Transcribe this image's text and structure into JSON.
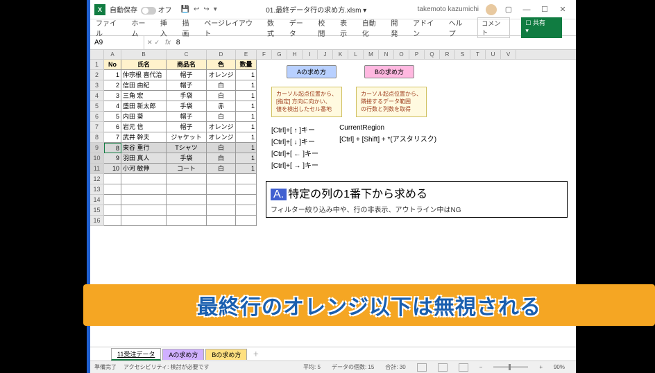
{
  "titlebar": {
    "autosave_label": "自動保存",
    "autosave_state": "オフ",
    "filename": "01.最終データ行の求め方.xlsm ▾",
    "user": "takemoto kazumichi"
  },
  "ribbon": {
    "tabs": [
      "ファイル",
      "ホーム",
      "挿入",
      "描画",
      "ページレイアウト",
      "数式",
      "データ",
      "校閲",
      "表示",
      "自動化",
      "開発",
      "アドイン",
      "ヘルプ"
    ],
    "comment": "コメント",
    "share": "共有"
  },
  "formula": {
    "namebox": "A9",
    "value": "8"
  },
  "columns": [
    "A",
    "B",
    "C",
    "D",
    "E",
    "F",
    "G",
    "H",
    "I",
    "J",
    "K",
    "L",
    "M",
    "N",
    "O",
    "P",
    "Q",
    "R",
    "S",
    "T",
    "U",
    "V"
  ],
  "table": {
    "headers": {
      "no": "No",
      "name": "氏名",
      "product": "商品名",
      "color": "色",
      "qty": "数量"
    },
    "rows": [
      {
        "no": "1",
        "name": "仲宗根 喜代治",
        "product": "帽子",
        "color": "オレンジ",
        "qty": "1"
      },
      {
        "no": "2",
        "name": "信田 由紀",
        "product": "帽子",
        "color": "白",
        "qty": "1"
      },
      {
        "no": "3",
        "name": "三角 宏",
        "product": "手袋",
        "color": "白",
        "qty": "1"
      },
      {
        "no": "4",
        "name": "盛田 新太郎",
        "product": "手袋",
        "color": "赤",
        "qty": "1"
      },
      {
        "no": "5",
        "name": "内田 葵",
        "product": "帽子",
        "color": "白",
        "qty": "1"
      },
      {
        "no": "6",
        "name": "岩元 信",
        "product": "帽子",
        "color": "オレンジ",
        "qty": "1"
      },
      {
        "no": "7",
        "name": "武井 幹夫",
        "product": "ジャケット",
        "color": "オレンジ",
        "qty": "1"
      },
      {
        "no": "8",
        "name": "東谷 重行",
        "product": "Tシャツ",
        "color": "白",
        "qty": "1"
      },
      {
        "no": "9",
        "name": "羽田 真人",
        "product": "手袋",
        "color": "白",
        "qty": "1"
      },
      {
        "no": "10",
        "name": "小河 敏伸",
        "product": "コート",
        "color": "白",
        "qty": "1"
      }
    ]
  },
  "info": {
    "btnA": "Aの求め方",
    "btnB": "Bの求め方",
    "yboxA": [
      "カーソル起点位置から、",
      "[指定] 方向に向かい、",
      "値を検出したセル番地"
    ],
    "yboxB": [
      "カーソル起点位置から、",
      "隣接するデータ範囲",
      "の行数と列数を取得"
    ],
    "keysA": [
      "[Ctrl]+[ ↑ ]キー",
      "[Ctrl]+[ ↓ ]キー",
      "[Ctrl]+[ ← ]キー",
      "[Ctrl]+[ → ]キー"
    ],
    "keysB": [
      "CurrentRegion",
      "[Ctrl] + [Shift] + *(アスタリスク)"
    ],
    "section_letter": "A.",
    "section_title": "特定の列の1番下から求める",
    "section_sub": "フィルター絞り込み中や、行の非表示、アウトライン中はNG"
  },
  "overlay": "最終行のオレンジ以下は無視される",
  "sheettabs": {
    "active": "11受注データ",
    "purple": "Aの求め方",
    "yellow": "Bの求め方"
  },
  "status": {
    "ready": "準備完了",
    "access": "アクセシビリティ: 検討が必要です",
    "avg": "平均: 5",
    "count": "データの個数: 15",
    "sum": "合計: 30",
    "zoom": "90%"
  }
}
